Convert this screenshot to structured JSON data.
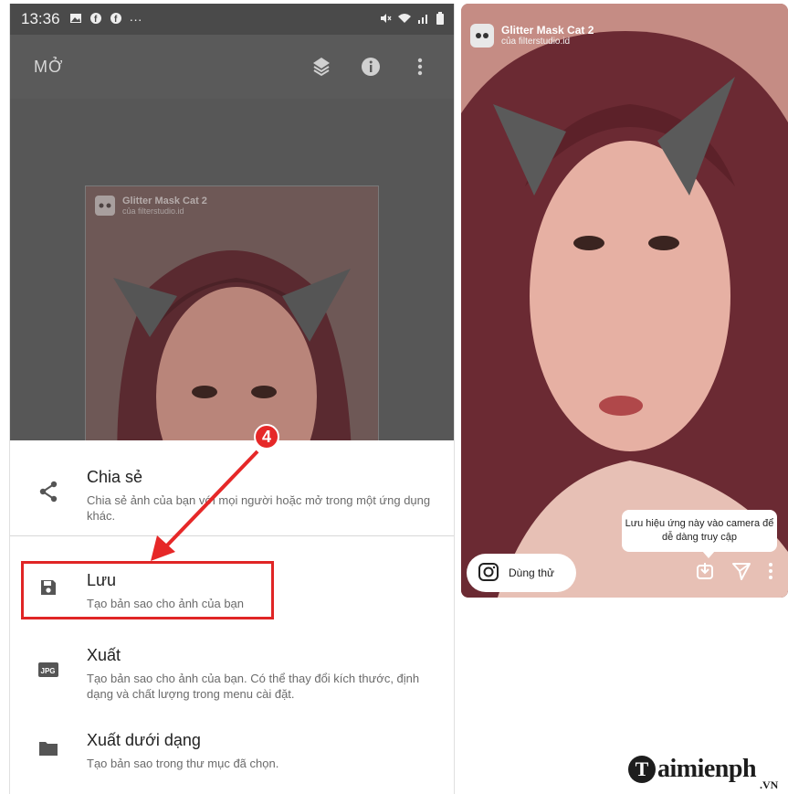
{
  "left_phone": {
    "status_bar": {
      "time": "13:36",
      "dots": "···"
    },
    "appbar": {
      "title": "MỞ"
    },
    "preview": {
      "filter_name": "Glitter Mask Cat 2",
      "filter_by": "của filterstudio.id"
    },
    "step_number": "4",
    "sheet": {
      "items": [
        {
          "title": "Chia sẻ",
          "desc": "Chia sẻ ảnh của bạn với mọi người hoặc mở trong một ứng dụng khác."
        },
        {
          "title": "Lưu",
          "desc": "Tạo bản sao cho ảnh của bạn"
        },
        {
          "title": "Xuất",
          "desc": "Tạo bản sao cho ảnh của bạn. Có thể thay đổi kích thước, định dạng và chất lượng trong menu cài đặt."
        },
        {
          "title": "Xuất dưới dạng",
          "desc": "Tạo bản sao trong thư mục đã chọn."
        }
      ],
      "jpg_label": "JPG"
    }
  },
  "right_phone": {
    "filter_name": "Glitter Mask Cat 2",
    "filter_by": "của filterstudio.id",
    "tooltip": "Lưu hiệu ứng này vào camera để dễ dàng truy cập",
    "try_button": "Dùng thử"
  },
  "watermark": {
    "brand": "aimienph",
    "suffix": ".VN"
  },
  "colors": {
    "highlight": "#e02525",
    "badge": "#e62828",
    "dim": "#575757"
  }
}
